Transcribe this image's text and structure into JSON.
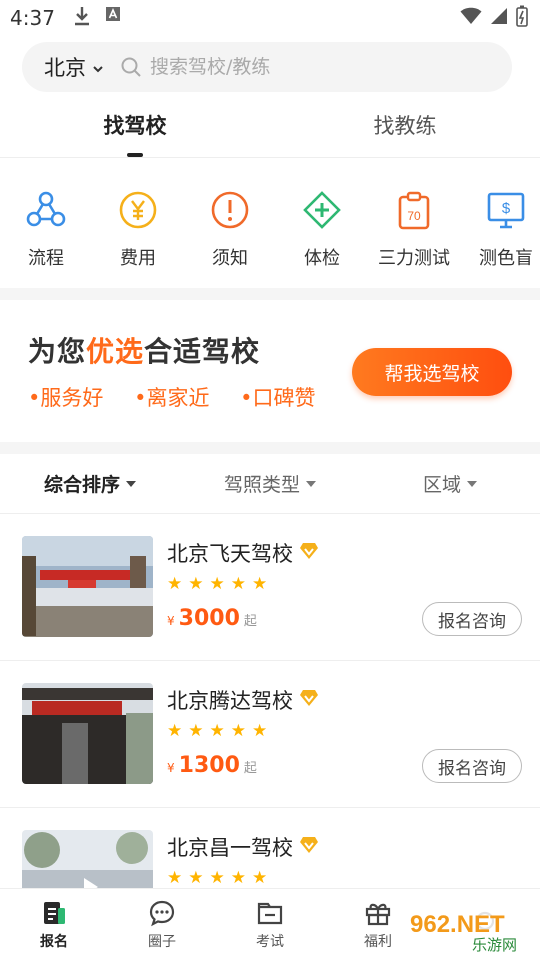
{
  "status_bar": {
    "time": "4:37"
  },
  "search": {
    "city": "北京",
    "placeholder": "搜索驾校/教练"
  },
  "tabs": [
    {
      "label": "找驾校",
      "active": true
    },
    {
      "label": "找教练",
      "active": false
    }
  ],
  "categories": [
    {
      "label": "流程",
      "icon": "flow-icon",
      "color": "#3a8ee6"
    },
    {
      "label": "费用",
      "icon": "yen-coin-icon",
      "color": "#f5b01a"
    },
    {
      "label": "须知",
      "icon": "exclamation-icon",
      "color": "#f06a2a"
    },
    {
      "label": "体检",
      "icon": "medical-cross-icon",
      "color": "#2eb872"
    },
    {
      "label": "三力测试",
      "icon": "test-clipboard-icon",
      "color": "#f06a2a",
      "icon_text": "70"
    },
    {
      "label": "测色盲",
      "icon": "monitor-dollar-icon",
      "color": "#3a8ee6"
    }
  ],
  "banner": {
    "headline_pre": "为您",
    "headline_highlight": "优选",
    "headline_post": "合适驾校",
    "features": [
      "服务好",
      "离家近",
      "口碑赞"
    ],
    "button_label": "帮我选驾校"
  },
  "filters": [
    {
      "label": "综合排序",
      "active": true
    },
    {
      "label": "驾照类型",
      "active": false
    },
    {
      "label": "区域",
      "active": false
    }
  ],
  "schools": [
    {
      "name": "北京飞天驾校",
      "rating": 5,
      "currency": "¥",
      "price": "3000",
      "price_suffix": "起",
      "action": "报名咨询"
    },
    {
      "name": "北京腾达驾校",
      "rating": 5,
      "currency": "¥",
      "price": "1300",
      "price_suffix": "起",
      "action": "报名咨询"
    },
    {
      "name": "北京昌一驾校",
      "rating": 5,
      "currency": "¥",
      "price": "",
      "price_suffix": "",
      "action": ""
    }
  ],
  "bottom_nav": [
    {
      "label": "报名",
      "icon": "signup-doc-icon",
      "active": true
    },
    {
      "label": "圈子",
      "icon": "chat-bubble-icon",
      "active": false
    },
    {
      "label": "考试",
      "icon": "exam-folder-icon",
      "active": false
    },
    {
      "label": "福利",
      "icon": "gift-icon",
      "active": false
    },
    {
      "label": "",
      "icon": "search-icon",
      "active": false
    }
  ],
  "watermark": {
    "line1": "962.NET",
    "line2": "乐游网"
  },
  "colors": {
    "accent": "#ff5a12",
    "star": "#ffb400",
    "verified": "#f5b01a"
  }
}
